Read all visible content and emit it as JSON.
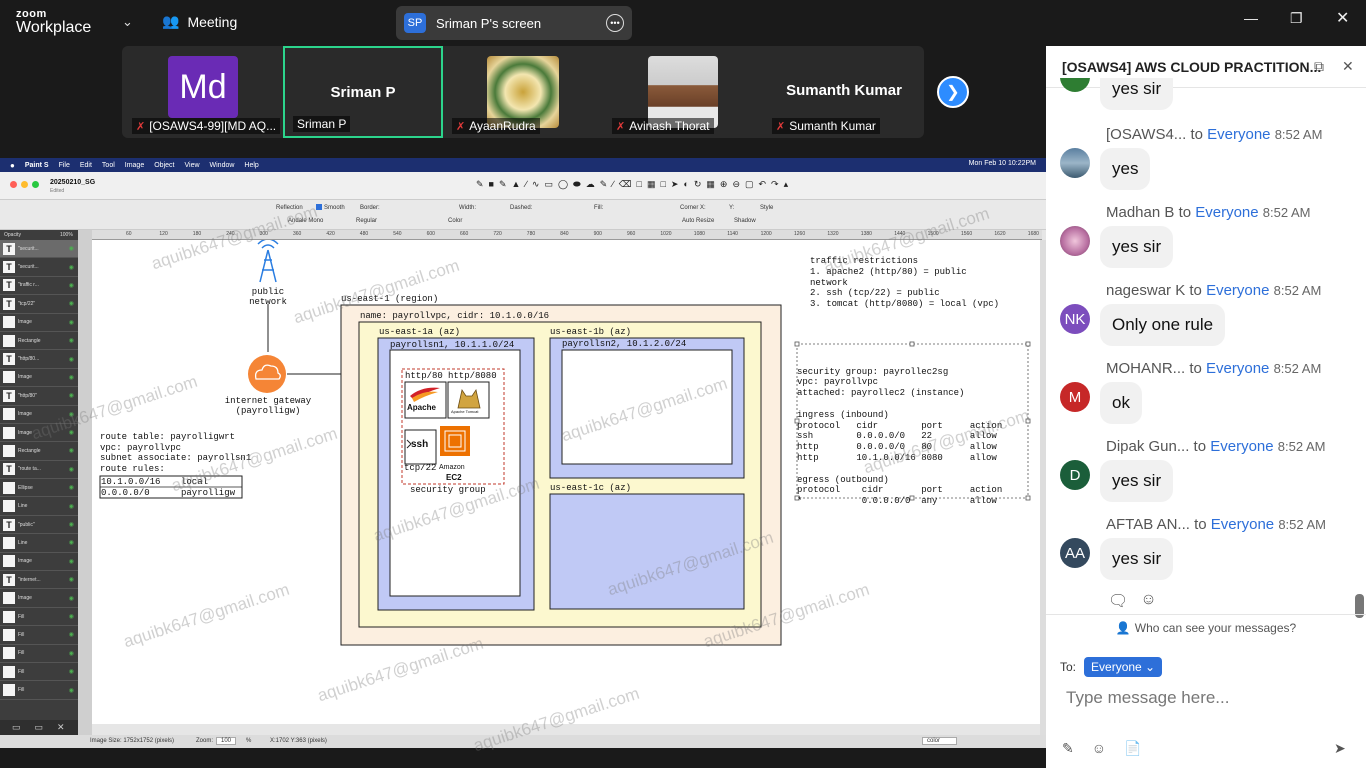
{
  "app": {
    "brand_line1": "zoom",
    "brand_line2": "Workplace",
    "meeting_label": "Meeting",
    "screen_pill_initials": "SP",
    "screen_pill_text": "Sriman P's screen"
  },
  "participants": [
    {
      "tile_text": "Md",
      "name": "[OSAWS4-99][MD AQ..."
    },
    {
      "tile_text": "Sriman P",
      "name": "Sriman P"
    },
    {
      "tile_text": "",
      "name": "AyaanRudra"
    },
    {
      "tile_text": "",
      "name": "Avinash Thorat"
    },
    {
      "tile_text": "Sumanth Kumar",
      "name": "Sumanth Kumar"
    }
  ],
  "paint": {
    "menubar": [
      "Paint S",
      "File",
      "Edit",
      "Tool",
      "Image",
      "Object",
      "View",
      "Window",
      "Help"
    ],
    "clock": "Mon Feb 10  10:22PM",
    "doc_name": "20250210_SG",
    "doc_status": "Edited",
    "opt_row1": [
      "Reflection",
      "Smooth",
      "Border:",
      "Width:",
      "Dashed:",
      "Fill:",
      "Corner X:",
      "Y:",
      "Style"
    ],
    "opt_row2": [
      "Andale Mono",
      "Regular",
      "Color",
      "Auto Resize",
      "Shadow"
    ],
    "opacity_label": "Opacity",
    "opacity_value": "100%",
    "layers": [
      "\"securit...",
      "\"securit...",
      "\"traffic r...",
      "\"tcp/22\"",
      "Image",
      "Rectangle",
      "\"http/80...",
      "Image",
      "\"http/80\"",
      "Image",
      "Image",
      "Rectangle",
      "\"route ta...",
      "Ellipse",
      "Line",
      "\"public\"",
      "Line",
      "Image",
      "\"internet...",
      "Image",
      "Fill",
      "Fill",
      "Fill",
      "Fill",
      "Fill"
    ],
    "ruler_ticks": [
      "60",
      "120",
      "180",
      "240",
      "300",
      "360",
      "420",
      "480",
      "540",
      "600",
      "660",
      "720",
      "780",
      "840",
      "900",
      "960",
      "1020",
      "1080",
      "1140",
      "1200",
      "1260",
      "1320",
      "1380",
      "1440",
      "1500",
      "1560",
      "1620",
      "1680"
    ],
    "status_left": "Image Size: 1752x1752 (pixels)",
    "zoom_label": "Zoom:",
    "zoom_value": "100",
    "zoom_unit": "%",
    "cursor_pos": "X:1702 Y:363 (pixels)",
    "status_color": "color"
  },
  "diagram": {
    "public_network": [
      "public",
      "network"
    ],
    "internet_gateway": [
      "internet gateway",
      "(payrolligw)"
    ],
    "route_table": [
      "route table: payrolligwrt",
      "vpc: payrollvpc",
      "subnet associate: payrollsn1",
      "route rules:"
    ],
    "route_rules": [
      [
        "10.1.0.0/16",
        "local"
      ],
      [
        "0.0.0.0/0",
        "payrolligw"
      ]
    ],
    "region": "us-east-1 (region)",
    "vpc": "name: payrollvpc, cidr: 10.1.0.0/16",
    "az1a": "us-east-1a (az)",
    "az1b": "us-east-1b (az)",
    "az1c": "us-east-1c (az)",
    "subnet1": "payrollsn1, 10.1.1.0/24",
    "subnet2": "payrollsn2, 10.1.2.0/24",
    "http80": "http/80",
    "http8080": "http/8080",
    "apache": "Apache",
    "tomcat": "Apache Tomcat",
    "ssh": "ssh",
    "tcp22": "tcp/22",
    "amazon": "Amazon",
    "ec2": "EC2",
    "sg_label": "security group",
    "traffic": [
      "traffic restrictions",
      "1. apache2 (http/80) = public",
      "network",
      "2. ssh (tcp/22) = public",
      "3. tomcat (http/8080) = local (vpc)"
    ],
    "sg_block": [
      "security group: payrollec2sg",
      "vpc: payrollvpc",
      "attached: payrollec2 (instance)",
      "",
      "ingress (inbound)",
      "protocol   cidr        port     action",
      "ssh        0.0.0.0/0   22       allow",
      "http       0.0.0.0/0   80       allow",
      "http       10.1.0.0/16 8080     allow",
      "",
      "egress (outbound)",
      "protocol    cidr       port     action",
      "*           0.0.0.0/0  any      allow"
    ]
  },
  "watermark": "aquibk647@gmail.com",
  "chat": {
    "title": "[OSAWS4] AWS CLOUD PRACTITION...",
    "messages": [
      {
        "sender": "",
        "to": "",
        "time": "",
        "text": "yes sir",
        "initials": "",
        "color": "#2e7d32"
      },
      {
        "sender": "[OSAWS4...",
        "to": "Everyone",
        "time": "8:52 AM",
        "text": "yes",
        "initials": "",
        "color": "#6b8fa8"
      },
      {
        "sender": "Madhan B",
        "to": "Everyone",
        "time": "8:52 AM",
        "text": "yes sir",
        "initials": "",
        "color": "#c98bb5"
      },
      {
        "sender": "nageswar K",
        "to": "Everyone",
        "time": "8:52 AM",
        "text": "Only one rule",
        "initials": "NK",
        "color": "#7c4dbd"
      },
      {
        "sender": "MOHANR...",
        "to": "Everyone",
        "time": "8:52 AM",
        "text": "ok",
        "initials": "M",
        "color": "#c62828"
      },
      {
        "sender": "Dipak Gun...",
        "to": "Everyone",
        "time": "8:52 AM",
        "text": "yes sir",
        "initials": "D",
        "color": "#1b5e3a"
      },
      {
        "sender": "AFTAB AN...",
        "to": "Everyone",
        "time": "8:52 AM",
        "text": "yes sir",
        "initials": "AA",
        "color": "#34495e"
      }
    ],
    "to_word": "to",
    "who_can_see": "Who can see your messages?",
    "to_label": "To:",
    "to_value": "Everyone",
    "input_placeholder": "Type message here..."
  }
}
